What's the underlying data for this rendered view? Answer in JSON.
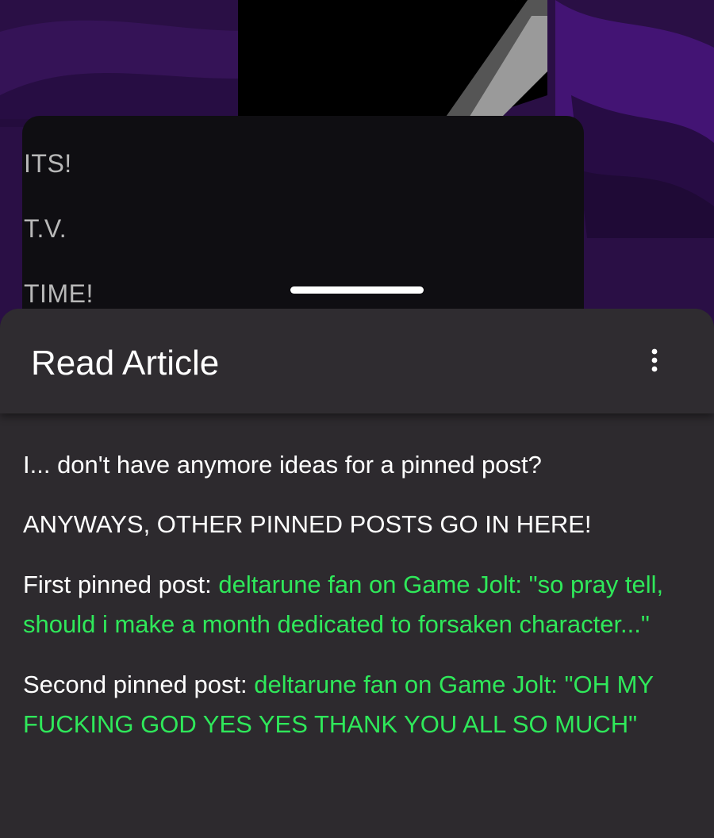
{
  "background": {
    "lines": [
      "ITS!",
      "T.V.",
      "TIME!"
    ]
  },
  "sheet": {
    "title": "Read Article",
    "menu_icon": "more-vertical-icon",
    "paragraphs": [
      {
        "text": "I... don't have anymore ideas for a pinned post?"
      },
      {
        "text": "ANYWAYS, OTHER PINNED POSTS GO IN HERE!"
      },
      {
        "prefix": "First pinned post: ",
        "link": "deltarune fan on Game Jolt: \"so pray tell, should i make a month dedicated to forsaken character...\""
      },
      {
        "prefix": "Second pinned post: ",
        "link": "deltarune fan on Game Jolt: \"OH MY FUCKING GOD YES YES THANK YOU ALL SO MUCH\""
      }
    ]
  },
  "colors": {
    "link": "#2fe85a",
    "sheet_bg": "#2d2a2e",
    "text": "#ffffff"
  }
}
